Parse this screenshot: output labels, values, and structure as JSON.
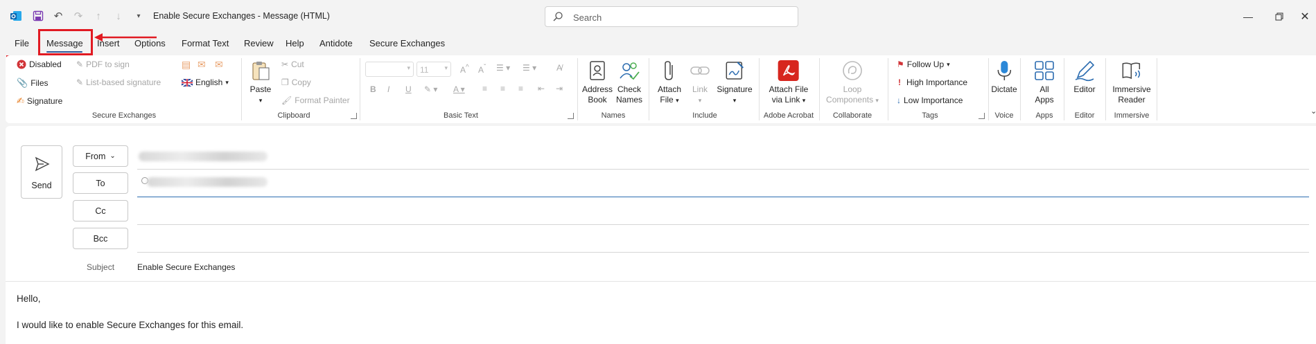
{
  "window": {
    "title": "Enable Secure Exchanges  -  Message (HTML)",
    "search_placeholder": "Search"
  },
  "tabs": [
    "File",
    "Message",
    "Insert",
    "Options",
    "Format Text",
    "Review",
    "Help",
    "Antidote",
    "Secure Exchanges"
  ],
  "active_tab": "Message",
  "ribbon": {
    "secure_exchanges": {
      "label": "Secure Exchanges",
      "disabled_btn": "Disabled",
      "files_btn": "Files",
      "signature_btn": "Signature",
      "pdf_to_sign": "PDF to sign",
      "list_based_signature": "List-based signature",
      "language": "English"
    },
    "clipboard": {
      "label": "Clipboard",
      "paste": "Paste",
      "cut": "Cut",
      "copy": "Copy",
      "format_painter": "Format Painter"
    },
    "basic_text": {
      "label": "Basic Text",
      "font_size": "11"
    },
    "names": {
      "label": "Names",
      "address_book": [
        "Address",
        "Book"
      ],
      "check_names": [
        "Check",
        "Names"
      ]
    },
    "include": {
      "label": "Include",
      "attach_file": [
        "Attach",
        "File"
      ],
      "link": "Link",
      "signature": "Signature"
    },
    "adobe": {
      "label": "Adobe Acrobat",
      "attach_via_link": [
        "Attach File",
        "via Link"
      ]
    },
    "collaborate": {
      "label": "Collaborate",
      "loop": [
        "Loop",
        "Components"
      ]
    },
    "tags": {
      "label": "Tags",
      "follow_up": "Follow Up",
      "high": "High Importance",
      "low": "Low Importance"
    },
    "voice": {
      "label": "Voice",
      "dictate": "Dictate"
    },
    "apps": {
      "label": "Apps",
      "all_apps": [
        "All",
        "Apps"
      ]
    },
    "editor": {
      "label": "Editor",
      "editor_btn": "Editor"
    },
    "immersive": {
      "label": "Immersive",
      "reader": [
        "Immersive",
        "Reader"
      ]
    }
  },
  "compose": {
    "send": "Send",
    "from": "From",
    "to": "To",
    "cc": "Cc",
    "bcc": "Bcc",
    "subject_label": "Subject",
    "subject_value": "Enable Secure Exchanges",
    "body": [
      "Hello,",
      "I would like to enable Secure Exchanges for this email."
    ]
  },
  "colors": {
    "highlight": "#e11a22",
    "accent": "#2b579a",
    "adobe": "#d7261e"
  }
}
